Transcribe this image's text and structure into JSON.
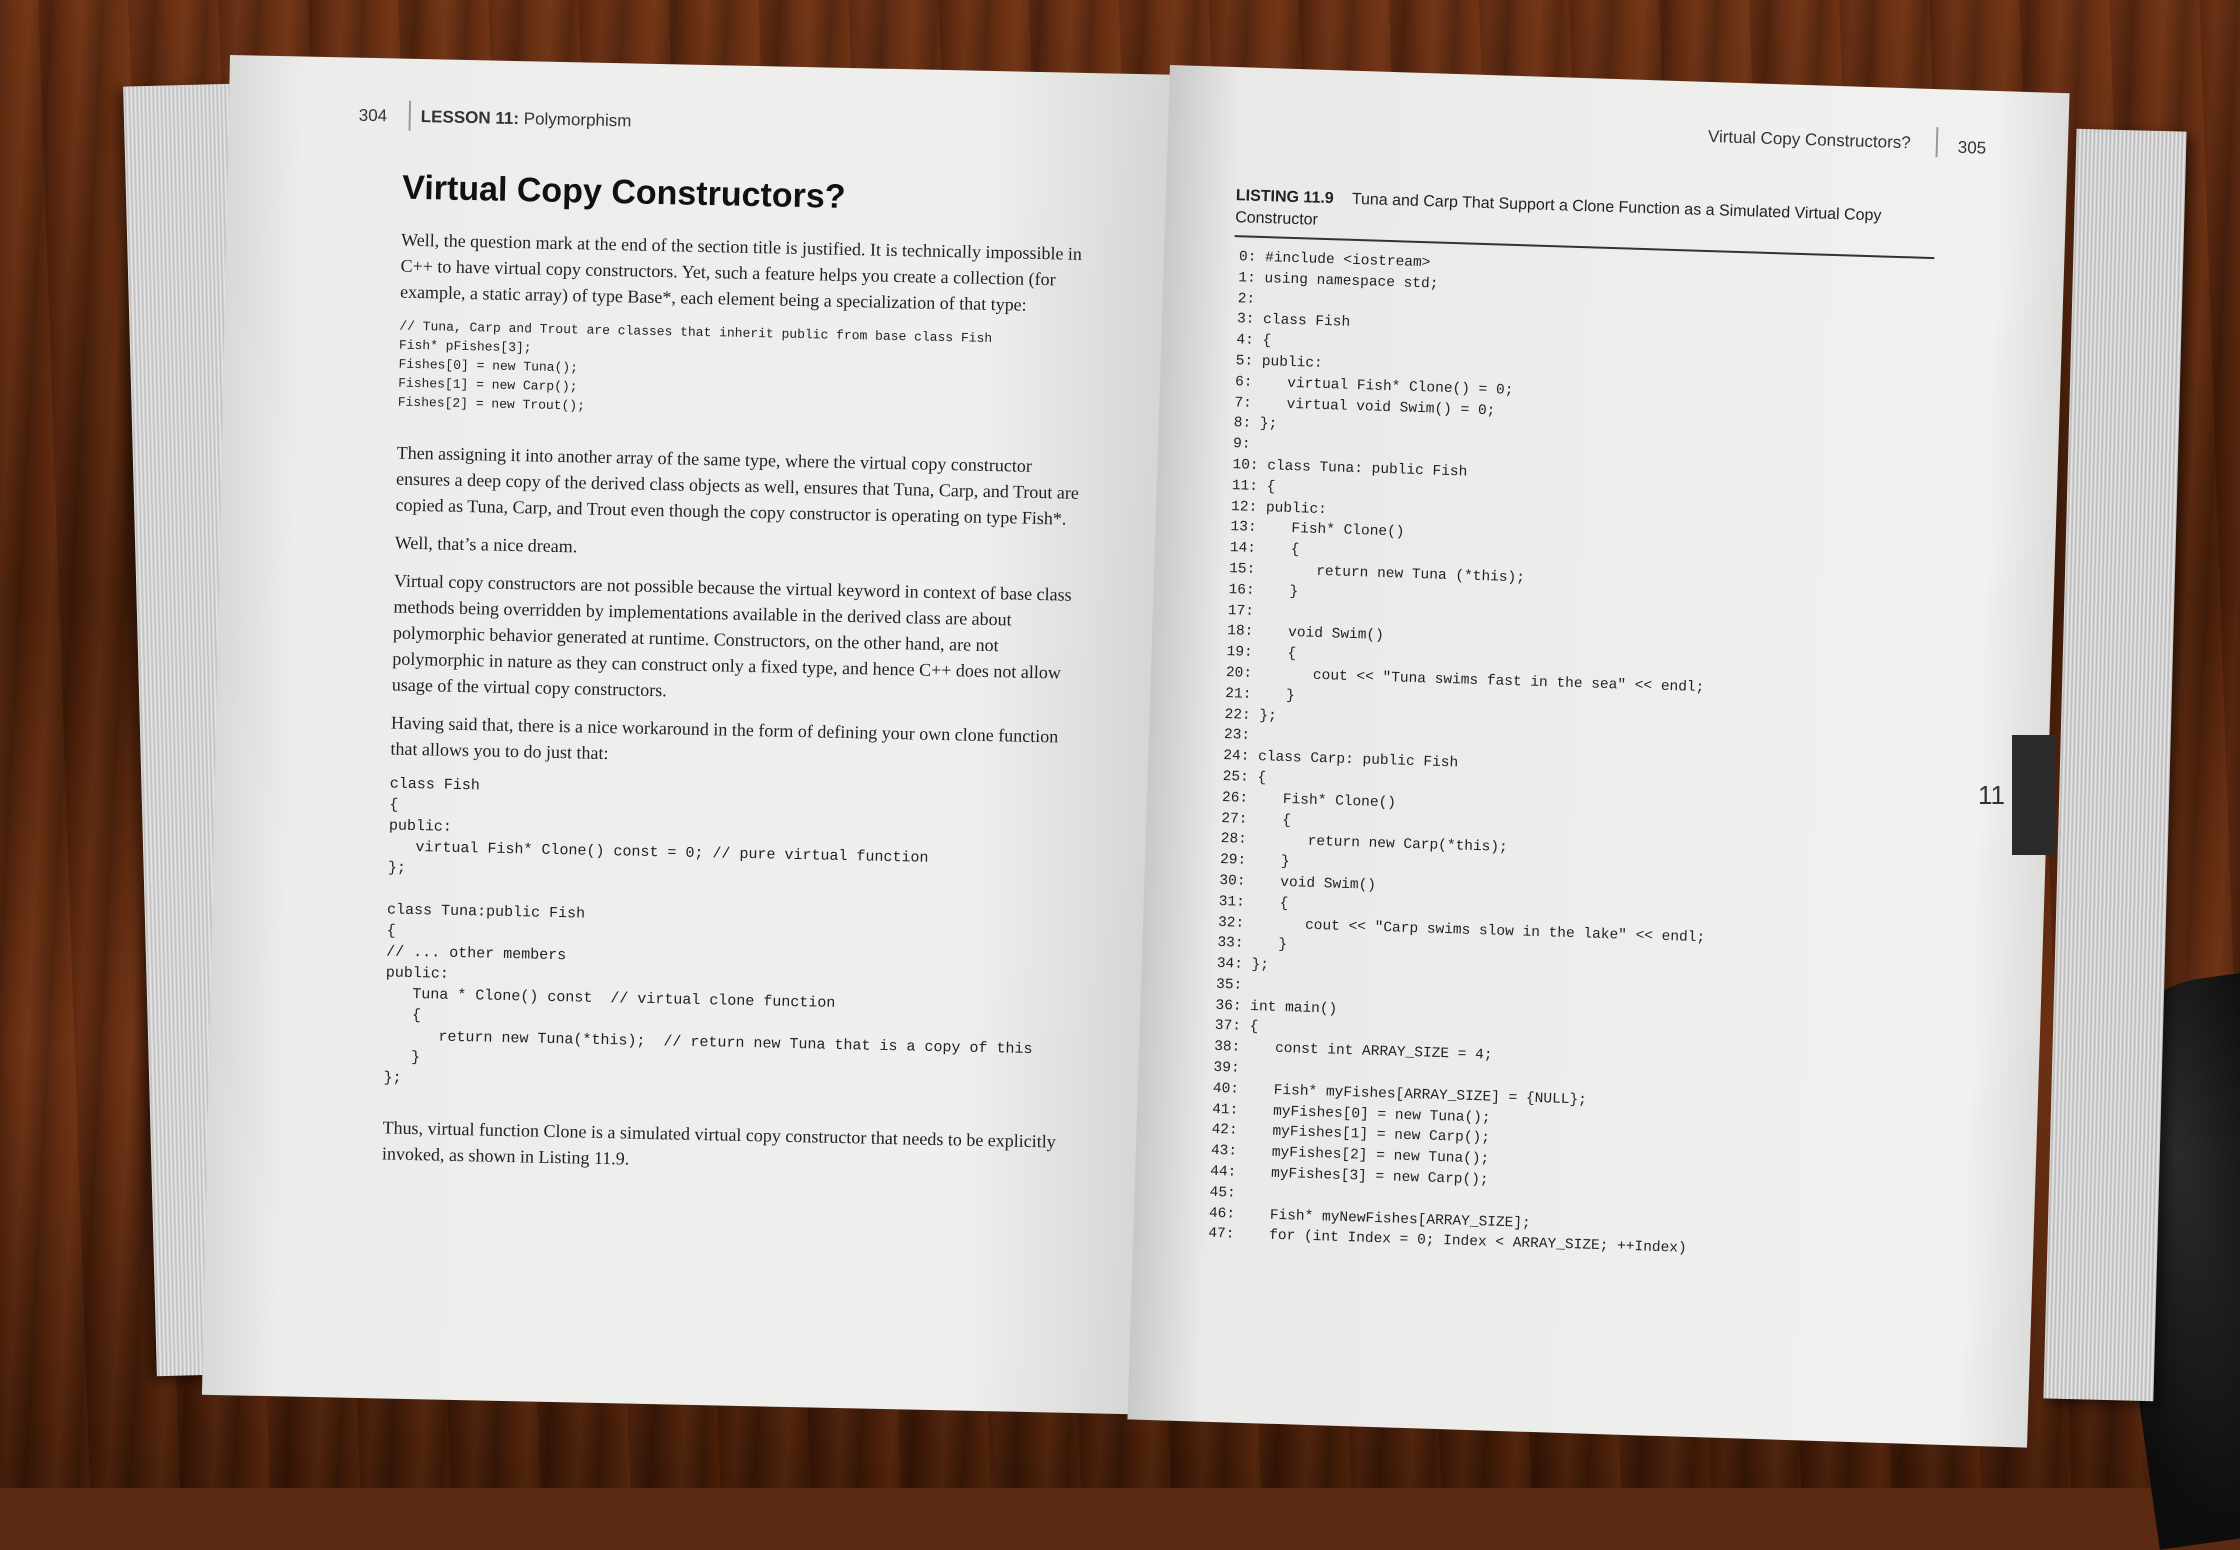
{
  "left_page": {
    "page_number": "304",
    "running_head_lesson": "LESSON 11:",
    "running_head_topic": "Polymorphism",
    "section_title": "Virtual Copy Constructors?",
    "para1": "Well, the question mark at the end of the section title is justified. It is technically impossible in C++ to have virtual copy constructors. Yet, such a feature helps you create a collection (for example, a static array) of type Base*, each element being a specialization of that type:",
    "code1": "// Tuna, Carp and Trout are classes that inherit public from base class Fish\nFish* pFishes[3];\nFishes[0] = new Tuna();\nFishes[1] = new Carp();\nFishes[2] = new Trout();",
    "para2": "Then assigning it into another array of the same type, where the virtual copy constructor ensures a deep copy of the derived class objects as well, ensures that Tuna, Carp, and Trout are copied as Tuna, Carp, and Trout even though the copy constructor is operating on type Fish*.",
    "para3": "Well, that’s a nice dream.",
    "para4": "Virtual copy constructors are not possible because the virtual keyword in context of base class methods being overridden by implementations available in the derived class are about polymorphic behavior generated at runtime. Constructors, on the other hand, are not polymorphic in nature as they can construct only a fixed type, and hence C++ does not allow usage of the virtual copy constructors.",
    "para5": "Having said that, there is a nice workaround in the form of defining your own clone function that allows you to do just that:",
    "code2": "class Fish\n{\npublic:\n   virtual Fish* Clone() const = 0; // pure virtual function\n};\n\nclass Tuna:public Fish\n{\n// ... other members\npublic:\n   Tuna * Clone() const  // virtual clone function\n   {\n      return new Tuna(*this);  // return new Tuna that is a copy of this\n   }\n};",
    "para6": "Thus, virtual function Clone is a simulated virtual copy constructor that needs to be explicitly invoked, as shown in Listing 11.9."
  },
  "right_page": {
    "page_number": "305",
    "running_head": "Virtual Copy Constructors?",
    "thumb_tab": "11",
    "listing_label": "LISTING 11.9",
    "listing_caption": "Tuna and Carp That Support a Clone Function as a Simulated Virtual Copy Constructor",
    "listing_code": "0: #include <iostream>\n1: using namespace std;\n2:\n3: class Fish\n4: {\n5: public:\n6:    virtual Fish* Clone() = 0;\n7:    virtual void Swim() = 0;\n8: };\n9:\n10: class Tuna: public Fish\n11: {\n12: public:\n13:    Fish* Clone()\n14:    {\n15:       return new Tuna (*this);\n16:    }\n17:\n18:    void Swim()\n19:    {\n20:       cout << \"Tuna swims fast in the sea\" << endl;\n21:    }\n22: };\n23:\n24: class Carp: public Fish\n25: {\n26:    Fish* Clone()\n27:    {\n28:       return new Carp(*this);\n29:    }\n30:    void Swim()\n31:    {\n32:       cout << \"Carp swims slow in the lake\" << endl;\n33:    }\n34: };\n35:\n36: int main()\n37: {\n38:    const int ARRAY_SIZE = 4;\n39:\n40:    Fish* myFishes[ARRAY_SIZE] = {NULL};\n41:    myFishes[0] = new Tuna();\n42:    myFishes[1] = new Carp();\n43:    myFishes[2] = new Tuna();\n44:    myFishes[3] = new Carp();\n45:\n46:    Fish* myNewFishes[ARRAY_SIZE];\n47:    for (int Index = 0; Index < ARRAY_SIZE; ++Index)"
  }
}
